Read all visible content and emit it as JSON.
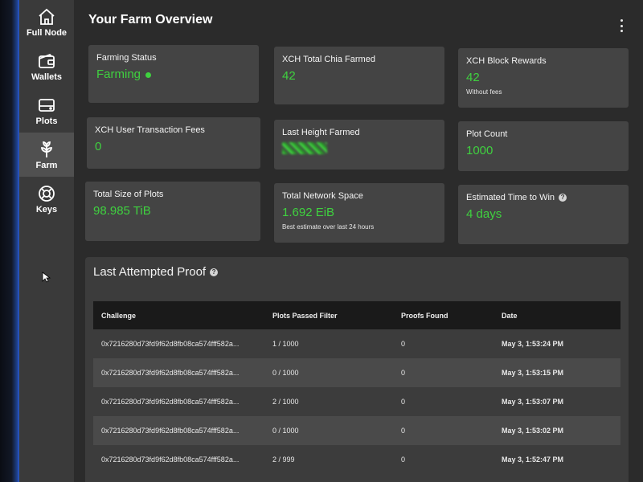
{
  "sidebar": {
    "items": [
      {
        "label": "Full Node",
        "icon": "home-icon",
        "active": false
      },
      {
        "label": "Wallets",
        "icon": "wallet-icon",
        "active": false
      },
      {
        "label": "Plots",
        "icon": "hard-drive-icon",
        "active": false
      },
      {
        "label": "Farm",
        "icon": "sprout-icon",
        "active": true
      },
      {
        "label": "Keys",
        "icon": "lifebuoy-icon",
        "active": false
      }
    ]
  },
  "header": {
    "title": "Your Farm Overview"
  },
  "cards": {
    "farming_status": {
      "label": "Farming Status",
      "value": "Farming"
    },
    "total_chia_farmed": {
      "label": "XCH Total Chia Farmed",
      "value": "42"
    },
    "block_rewards": {
      "label": "XCH Block Rewards",
      "value": "42",
      "sub": "Without fees"
    },
    "user_tx_fees": {
      "label": "XCH User Transaction Fees",
      "value": "0"
    },
    "last_height_farmed": {
      "label": "Last Height Farmed"
    },
    "plot_count": {
      "label": "Plot Count",
      "value": "1000"
    },
    "total_size": {
      "label": "Total Size of Plots",
      "value": "98.985 TiB"
    },
    "network_space": {
      "label": "Total Network Space",
      "value": "1.692 EiB",
      "sub": "Best estimate over last 24 hours"
    },
    "time_to_win": {
      "label": "Estimated Time to Win",
      "value": "4 days"
    }
  },
  "proof": {
    "title": "Last Attempted Proof",
    "columns": [
      "Challenge",
      "Plots Passed Filter",
      "Proofs Found",
      "Date"
    ],
    "rows": [
      [
        "0x7216280d73fd9f62d8fb08ca574fff582a...",
        "1 / 1000",
        "0",
        "May 3, 1:53:24 PM"
      ],
      [
        "0x7216280d73fd9f62d8fb08ca574fff582a...",
        "0 / 1000",
        "0",
        "May 3, 1:53:15 PM"
      ],
      [
        "0x7216280d73fd9f62d8fb08ca574fff582a...",
        "2 / 1000",
        "0",
        "May 3, 1:53:07 PM"
      ],
      [
        "0x7216280d73fd9f62d8fb08ca574fff582a...",
        "0 / 1000",
        "0",
        "May 3, 1:53:02 PM"
      ],
      [
        "0x7216280d73fd9f62d8fb08ca574fff582a...",
        "2 / 999",
        "0",
        "May 3, 1:52:47 PM"
      ]
    ]
  },
  "colors": {
    "accent_green": "#3fd13f",
    "card_bg": "#444444",
    "sidebar_bg": "#3a3a3a"
  }
}
